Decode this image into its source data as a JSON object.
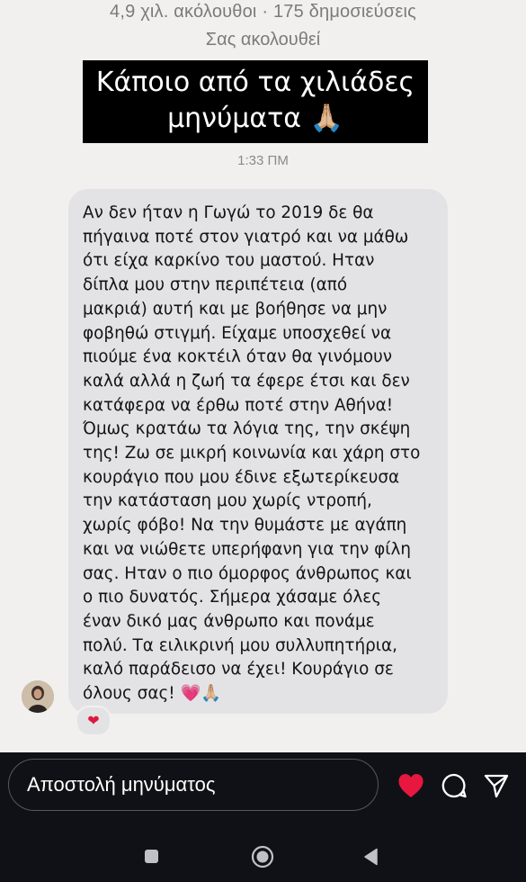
{
  "profile": {
    "stats": "4,9 χιλ. ακόλουθοι · 175 δημοσιεύσεις",
    "follows_you": "Σας ακολουθεί"
  },
  "banner": {
    "line1": "Κάποιο από τα χιλιάδες",
    "line2": "μηνύματα 🙏🏼"
  },
  "message": {
    "time": "1:33 ΠΜ",
    "text": "Αν δεν ήταν η Γωγώ το 2019 δε θα\nπήγαινα ποτέ στον γιατρό και να μάθω\nότι είχα καρκίνο του μαστού. Ηταν\nδίπλα μου στην περιπέτεια (από\nμακριά) αυτή και με βοήθησε να μην\nφοβηθώ στιγμή. Είχαμε υποσχεθεί να\nπιούμε ένα κοκτέιλ όταν θα γινόμουν\nκαλά αλλά η ζωή τα έφερε έτσι και δεν\nκατάφερα να έρθω ποτέ στην Αθήνα!\nΌμως κρατάω τα λόγια της, την σκέψη\nτης! Ζω σε μικρή κοινωνία και χάρη στο\nκουράγιο που μου έδινε εξωτερίκευσα\nτην κατάσταση μου χωρίς ντροπή,\nχωρίς φόβο! Να την θυμάστε με αγάπη\nκαι να νιώθετε υπερήφανη για την φίλη\nσας. Ηταν ο πιο όμορφος άνθρωπος και\nο πιο δυνατός. Σήμερα χάσαμε όλες\nέναν δικό μας άνθρωπο και πονάμε\nπολύ. Τα ειλικρινή μου συλλυπητήρια,\nκαλό παράδεισο να έχει! Κουράγιο σε\nόλους σας! 💗🙏🏼",
    "reaction": "❤"
  },
  "composer": {
    "placeholder": "Αποστολή μηνύματος"
  },
  "icons": {
    "heart": "heart-icon",
    "reply": "speech-bubble-icon",
    "send": "paper-plane-icon",
    "nav_back": "triangle-back-icon",
    "nav_home": "circle-home-icon",
    "nav_recents": "square-recents-icon"
  },
  "colors": {
    "heart": "#e8173f",
    "bubble": "#e3e3e6",
    "banner": "#000000",
    "composer_bg": "#0f1116"
  }
}
